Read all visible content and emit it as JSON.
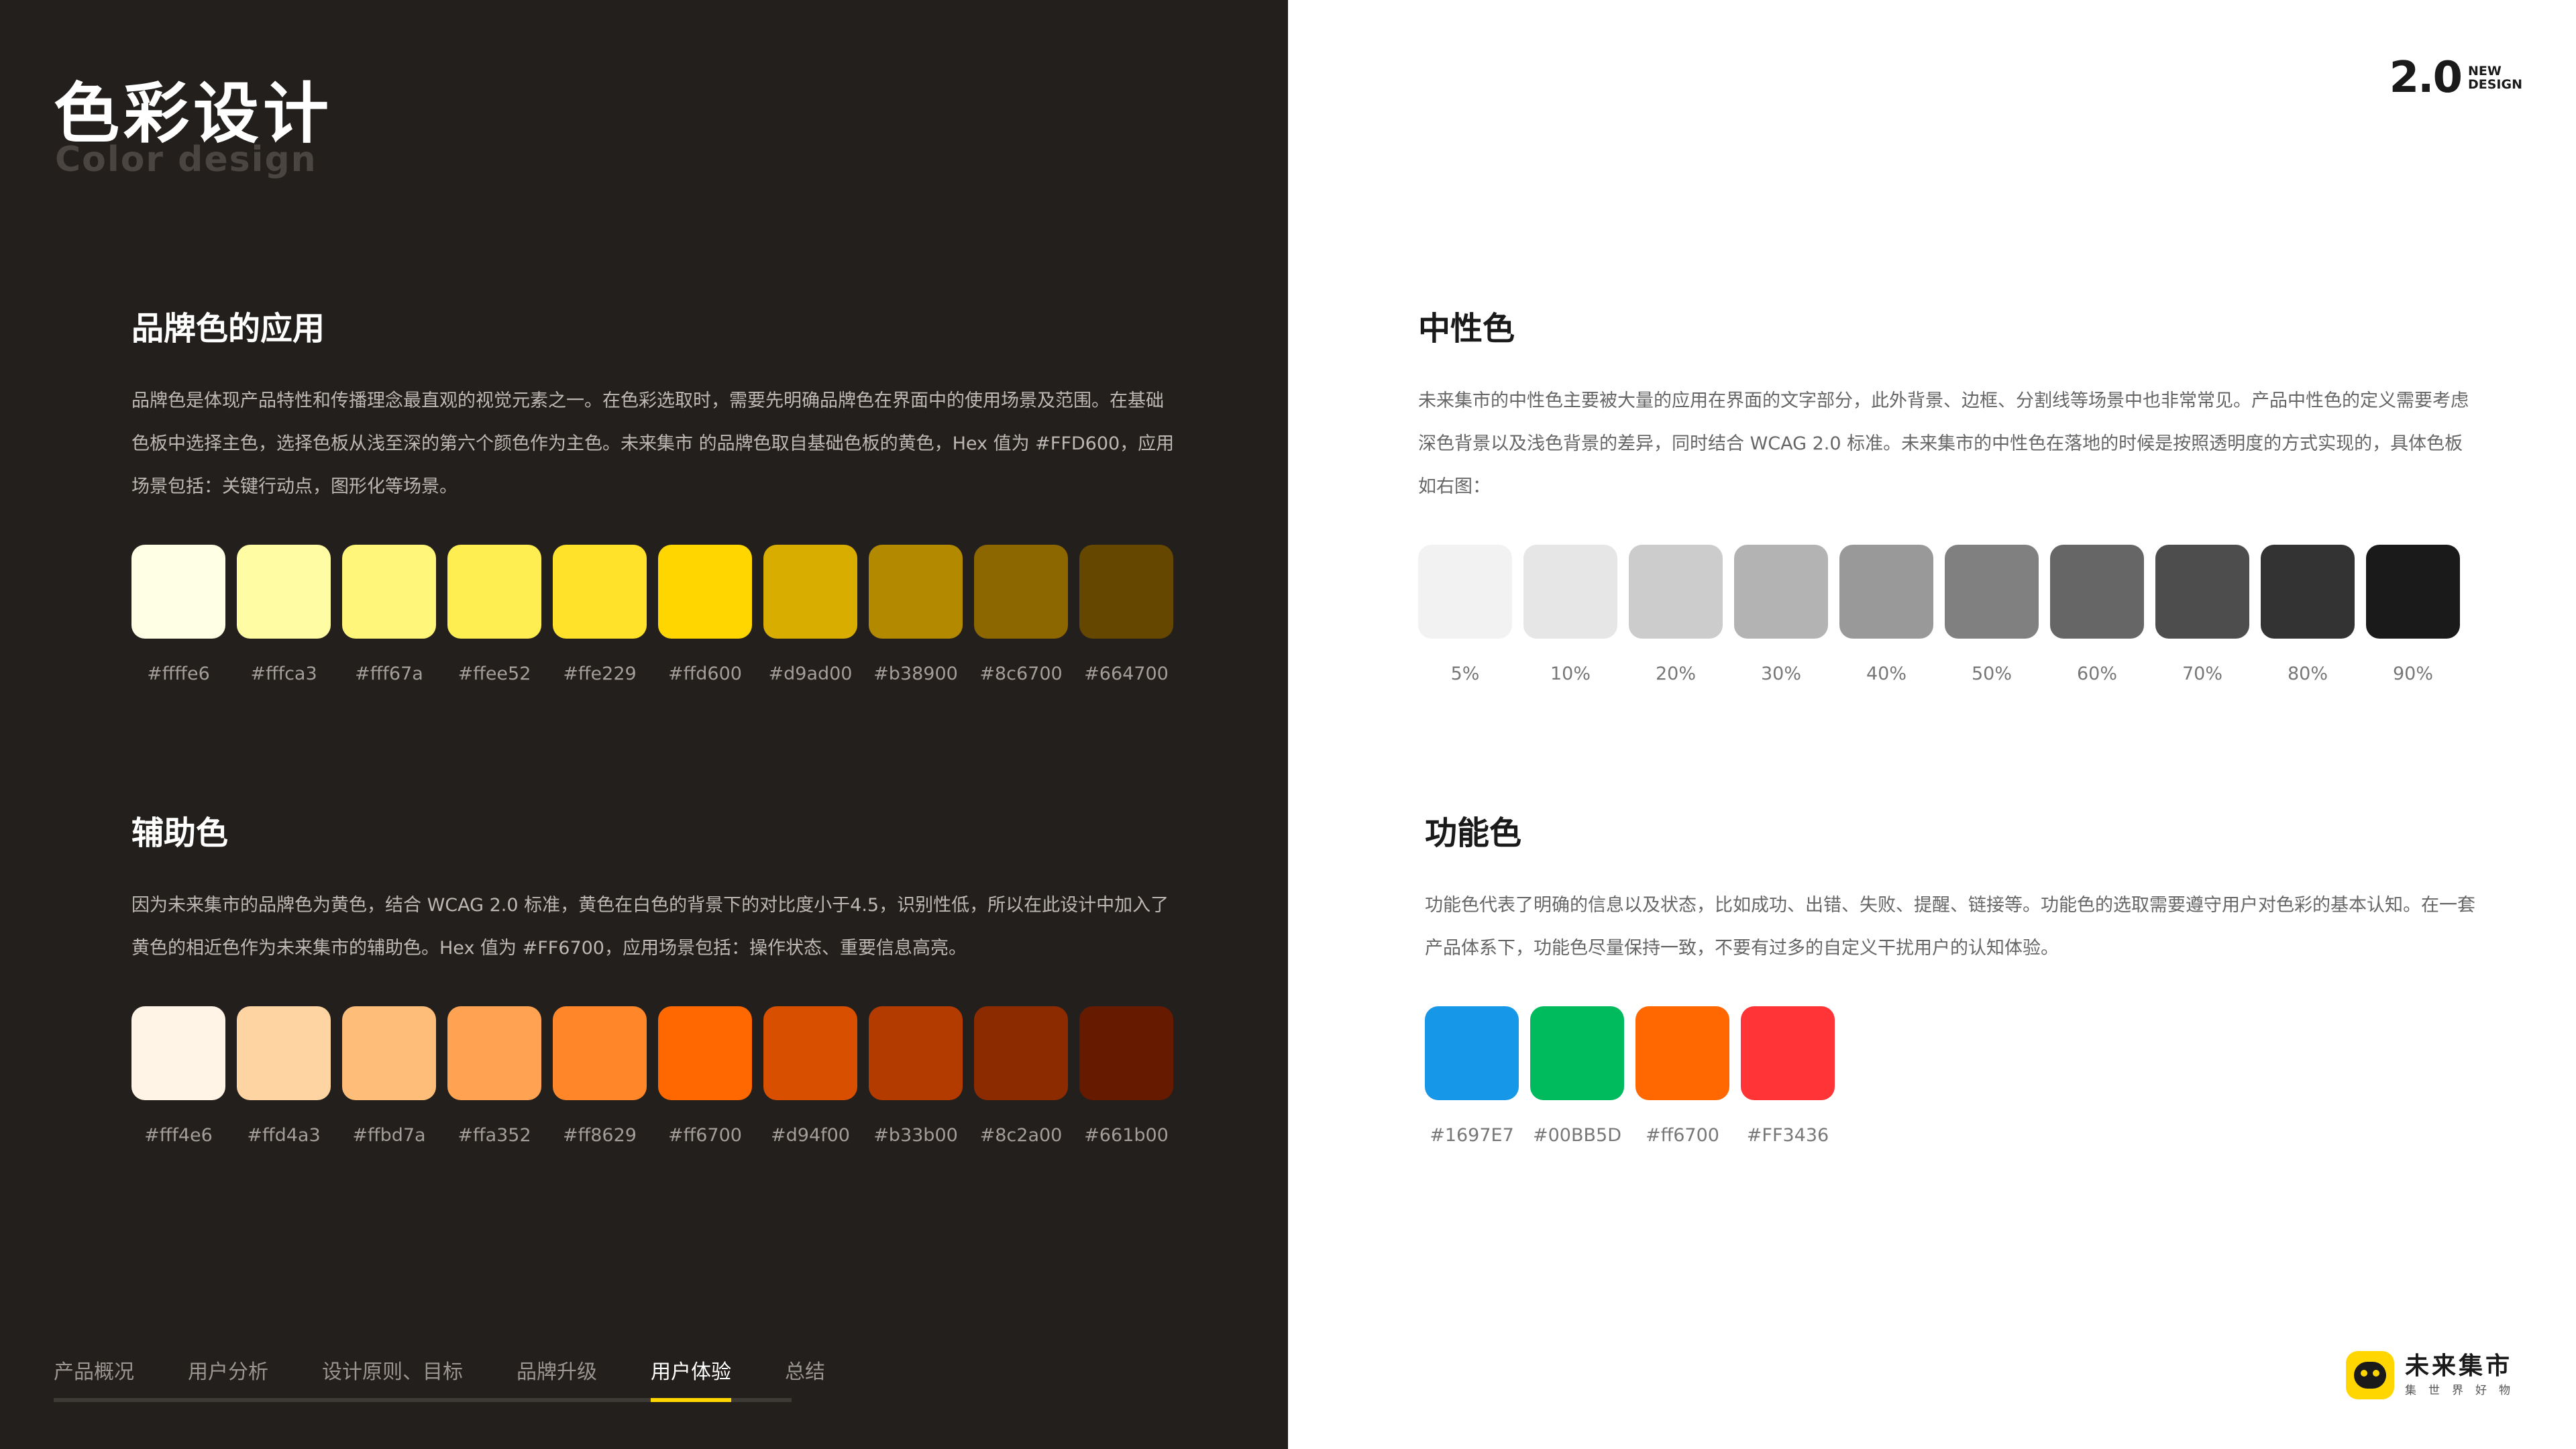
{
  "header": {
    "title": "色彩设计",
    "subtitle": "Color design"
  },
  "version": {
    "number": "2.0",
    "line1": "NEW",
    "line2": "DESIGN"
  },
  "brand_section": {
    "title": "品牌色的应用",
    "description": "品牌色是体现产品特性和传播理念最直观的视觉元素之一。在色彩选取时，需要先明确品牌色在界面中的使用场景及范围。在基础色板中选择主色，选择色板从浅至深的第六个颜色作为主色。未来集市 的品牌色取自基础色板的黄色，Hex 值为 #FFD600，应用场景包括：关键行动点，图形化等场景。",
    "swatches": [
      {
        "color": "#ffffe6",
        "label": "#ffffe6"
      },
      {
        "color": "#fffca3",
        "label": "#fffca3"
      },
      {
        "color": "#fff67a",
        "label": "#fff67a"
      },
      {
        "color": "#ffee52",
        "label": "#ffee52"
      },
      {
        "color": "#ffe229",
        "label": "#ffe229"
      },
      {
        "color": "#ffd600",
        "label": "#ffd600"
      },
      {
        "color": "#d9ad00",
        "label": "#d9ad00"
      },
      {
        "color": "#b38900",
        "label": "#b38900"
      },
      {
        "color": "#8c6700",
        "label": "#8c6700"
      },
      {
        "color": "#664700",
        "label": "#664700"
      }
    ]
  },
  "auxiliary_section": {
    "title": "辅助色",
    "description": "因为未来集市的品牌色为黄色，结合 WCAG 2.0 标准，黄色在白色的背景下的对比度小于4.5，识别性低，所以在此设计中加入了黄色的相近色作为未来集市的辅助色。Hex 值为 #FF6700，应用场景包括：操作状态、重要信息高亮。",
    "swatches": [
      {
        "color": "#fff4e6",
        "label": "#fff4e6"
      },
      {
        "color": "#ffd4a3",
        "label": "#ffd4a3"
      },
      {
        "color": "#ffbd7a",
        "label": "#ffbd7a"
      },
      {
        "color": "#ffa352",
        "label": "#ffa352"
      },
      {
        "color": "#ff8629",
        "label": "#ff8629"
      },
      {
        "color": "#ff6700",
        "label": "#ff6700"
      },
      {
        "color": "#d94f00",
        "label": "#d94f00"
      },
      {
        "color": "#b33b00",
        "label": "#b33b00"
      },
      {
        "color": "#8c2a00",
        "label": "#8c2a00"
      },
      {
        "color": "#661b00",
        "label": "#661b00"
      }
    ]
  },
  "neutral_section": {
    "title": "中性色",
    "description": "未来集市的中性色主要被大量的应用在界面的文字部分，此外背景、边框、分割线等场景中也非常常见。产品中性色的定义需要考虑深色背景以及浅色背景的差异，同时结合 WCAG 2.0 标准。未来集市的中性色在落地的时候是按照透明度的方式实现的，具体色板如右图：",
    "swatches": [
      {
        "color": "#f2f2f2",
        "label": "5%"
      },
      {
        "color": "#e6e6e6",
        "label": "10%"
      },
      {
        "color": "#cccccc",
        "label": "20%"
      },
      {
        "color": "#b3b3b3",
        "label": "30%"
      },
      {
        "color": "#999999",
        "label": "40%"
      },
      {
        "color": "#808080",
        "label": "50%"
      },
      {
        "color": "#666666",
        "label": "60%"
      },
      {
        "color": "#4d4d4d",
        "label": "70%"
      },
      {
        "color": "#333333",
        "label": "80%"
      },
      {
        "color": "#1a1a1a",
        "label": "90%"
      }
    ]
  },
  "functional_section": {
    "title": "功能色",
    "description": "功能色代表了明确的信息以及状态，比如成功、出错、失败、提醒、链接等。功能色的选取需要遵守用户对色彩的基本认知。在一套产品体系下，功能色尽量保持一致，不要有过多的自定义干扰用户的认知体验。",
    "swatches": [
      {
        "color": "#1697E7",
        "label": "#1697E7"
      },
      {
        "color": "#00BB5D",
        "label": "#00BB5D"
      },
      {
        "color": "#ff6700",
        "label": "#ff6700"
      },
      {
        "color": "#FF3436",
        "label": "#FF3436"
      }
    ]
  },
  "nav": {
    "items": [
      "产品概况",
      "用户分析",
      "设计原则、目标",
      "品牌升级",
      "用户体验",
      "总结"
    ],
    "active_index": 4
  },
  "footer_brand": {
    "name": "未来集市",
    "tagline": "集世界好物"
  },
  "colors": {
    "dark_bg": "#231f1c",
    "brand_yellow": "#ffd600"
  }
}
